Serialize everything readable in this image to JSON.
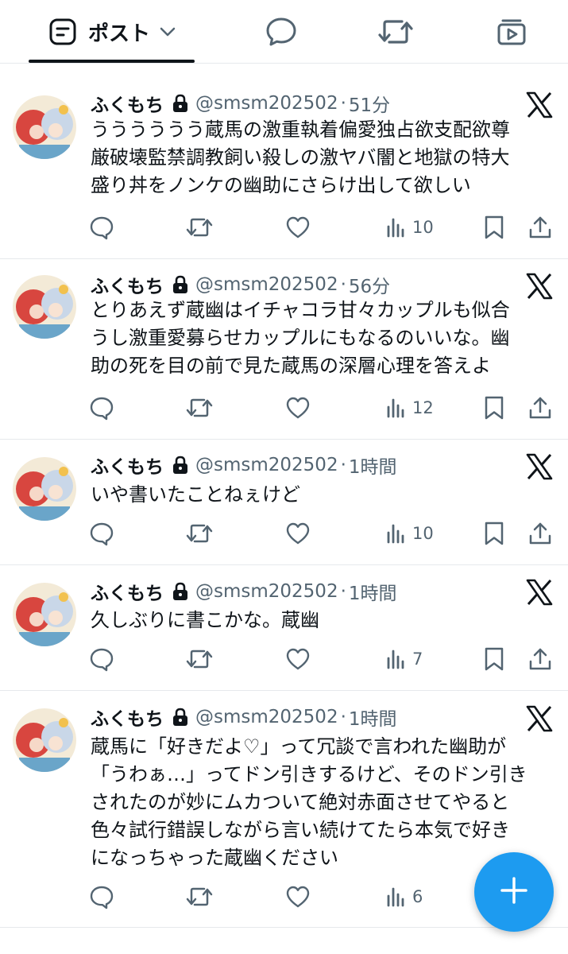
{
  "top_tabs": {
    "posts_label": "ポスト",
    "posts_icon": "posts-icon",
    "replies_icon": "speech-bubble-icon",
    "reposts_icon": "repost-icon",
    "media_icon": "media-icon"
  },
  "tweets": [
    {
      "name": "ふくもち",
      "handle": "@smsm202502",
      "separator": "·",
      "time": "51分",
      "lines": [
        "うううううう蔵馬の激重執着偏愛独占欲支配欲尊",
        "厳破壊監禁調教飼い殺しの激ヤバ闇と地獄の特大",
        "盛り丼をノンケの幽助にさらけ出して欲しい"
      ],
      "views": "10"
    },
    {
      "name": "ふくもち",
      "handle": "@smsm202502",
      "separator": "·",
      "time": "56分",
      "lines": [
        "とりあえず蔵幽はイチャコラ甘々カップルも似合",
        "うし激重愛募らせカップルにもなるのいいな。幽",
        "助の死を目の前で見た蔵馬の深層心理を答えよ"
      ],
      "views": "12"
    },
    {
      "name": "ふくもち",
      "handle": "@smsm202502",
      "separator": "·",
      "time": "1時間",
      "lines": [
        "いや書いたことねぇけど"
      ],
      "views": "10"
    },
    {
      "name": "ふくもち",
      "handle": "@smsm202502",
      "separator": "·",
      "time": "1時間",
      "lines": [
        "久しぶりに書こかな。蔵幽"
      ],
      "views": "7"
    },
    {
      "name": "ふくもち",
      "handle": "@smsm202502",
      "separator": "·",
      "time": "1時間",
      "lines": [
        "蔵馬に「好きだよ♡」って冗談で言われた幽助が",
        "「うわぁ…」ってドン引きするけど、そのドン引き",
        "されたのが妙にムカついて絶対赤面させてやると",
        "色々試行錯誤しながら言い続けてたら本気で好き",
        "になっちゃった蔵幽ください"
      ],
      "views": "6"
    }
  ],
  "icons": {
    "protected": "lock-icon",
    "platform": "x-logo-icon",
    "reply": "reply-icon",
    "repost": "repost-icon",
    "like": "heart-icon",
    "views": "views-icon",
    "bookmark": "bookmark-icon",
    "share": "share-icon",
    "compose": "plus-icon"
  },
  "colors": {
    "text": "#0f1419",
    "secondary": "#536471",
    "divider": "#e6e9ec",
    "fab": "#1d9bf0"
  }
}
